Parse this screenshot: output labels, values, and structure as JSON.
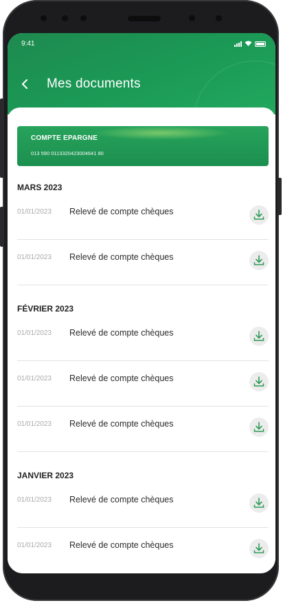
{
  "status_bar": {
    "time": "9:41"
  },
  "header": {
    "title": "Mes documents"
  },
  "account": {
    "name": "COMPTE EPARGNE",
    "number": "013 590 0113320423004641 80"
  },
  "sections": [
    {
      "month": "MARS 2023",
      "rows": [
        {
          "date": "01/01/2023",
          "label": "Relevé de compte chèques"
        },
        {
          "date": "01/01/2023",
          "label": "Relevé de compte chèques"
        }
      ]
    },
    {
      "month": "FÉVRIER 2023",
      "rows": [
        {
          "date": "01/01/2023",
          "label": "Relevé de compte chèques"
        },
        {
          "date": "01/01/2023",
          "label": "Relevé de compte chèques"
        },
        {
          "date": "01/01/2023",
          "label": "Relevé de compte chèques"
        }
      ]
    },
    {
      "month": "JANVIER 2023",
      "rows": [
        {
          "date": "01/01/2023",
          "label": "Relevé de compte chèques"
        },
        {
          "date": "01/01/2023",
          "label": "Relevé de compte chèques"
        }
      ]
    }
  ],
  "icons": {
    "back": "chevron-left-icon",
    "download": "download-icon"
  },
  "colors": {
    "brand_green": "#1b9a56",
    "icon_green": "#2e9b56",
    "separator": "#e2e2e2"
  }
}
